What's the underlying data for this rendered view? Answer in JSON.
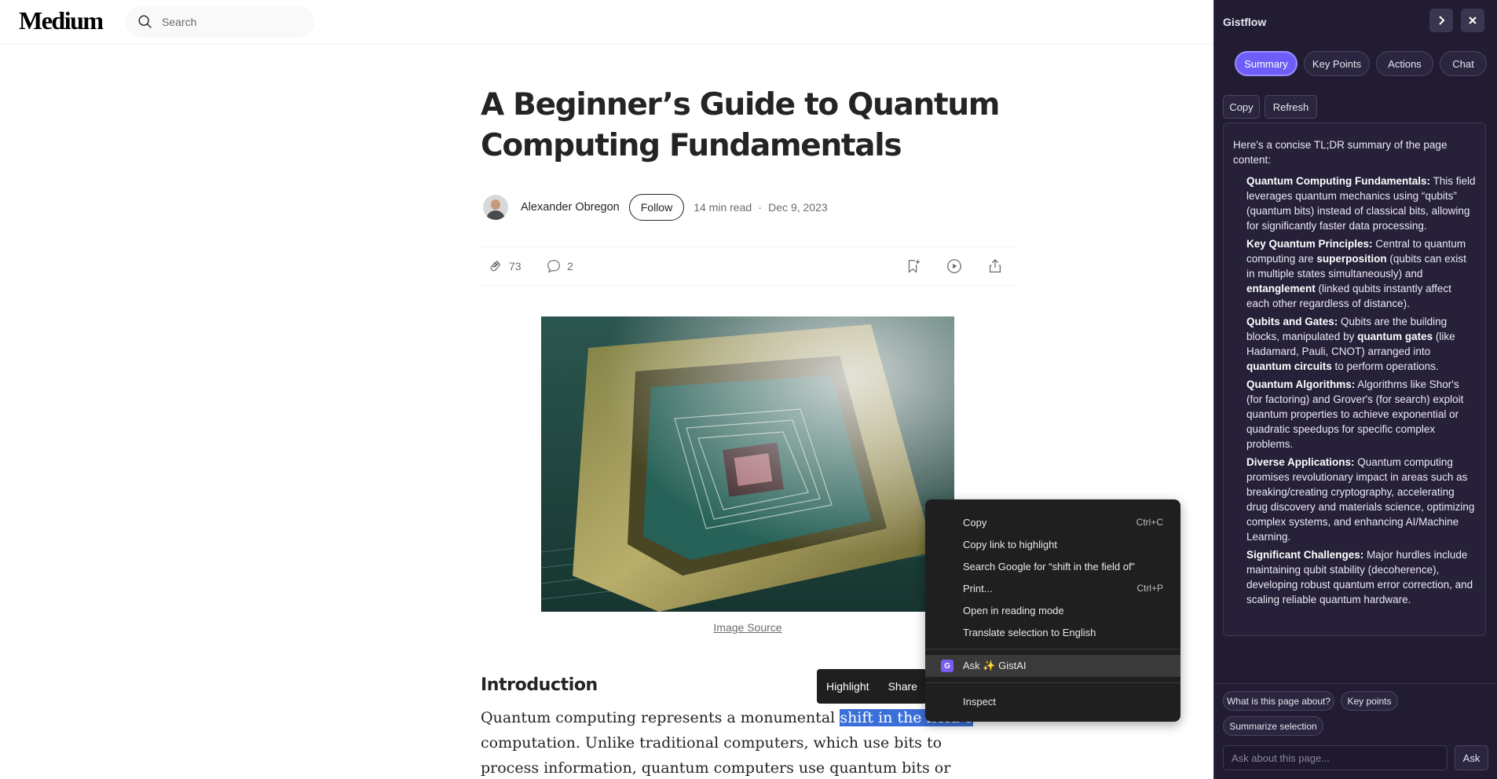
{
  "header": {
    "logo": "Medium",
    "search_placeholder": "Search"
  },
  "article": {
    "title": "A Beginner’s Guide to Quantum Computing Fundamentals",
    "author": "Alexander Obregon",
    "follow_label": "Follow",
    "read_time": "14 min read",
    "separator": "·",
    "date": "Dec 9, 2023",
    "claps": "73",
    "comments": "2",
    "image_caption": "Image Source",
    "section_heading": "Introduction",
    "paragraph_before": "Quantum computing represents a monumental ",
    "paragraph_selected": "shift in the field o",
    "paragraph_after": "computation. Unlike traditional computers, which use bits to process information, quantum computers use quantum bits or qubits. This"
  },
  "highlight_popup": {
    "highlight": "Highlight",
    "share": "Share"
  },
  "context_menu": {
    "items": [
      {
        "label": "Copy",
        "shortcut": "Ctrl+C"
      },
      {
        "label": "Copy link to highlight",
        "shortcut": ""
      },
      {
        "label": "Search Google for “shift in the field of”",
        "shortcut": ""
      },
      {
        "label": "Print...",
        "shortcut": "Ctrl+P"
      },
      {
        "label": "Open in reading mode",
        "shortcut": ""
      },
      {
        "label": "Translate selection to English",
        "shortcut": ""
      }
    ],
    "gist_item": "Ask ✨ GistAI",
    "inspect": "Inspect"
  },
  "sidebar": {
    "title": "Gistflow",
    "tabs": [
      "Summary",
      "Key Points",
      "Actions",
      "Chat"
    ],
    "active_tab": "Summary",
    "tools": [
      "Copy",
      "Refresh"
    ],
    "summary_intro": "Here's a concise TL;DR summary of the page content:",
    "points": [
      {
        "head": "Quantum Computing Fundamentals:",
        "text": " This field leverages quantum mechanics using “qubits” (quantum bits) instead of classical bits, allowing for significantly faster data processing."
      },
      {
        "head": "Key Quantum Principles:",
        "t1": " Central to quantum computing are ",
        "b1": "superposition",
        "t2": " (qubits can exist in multiple states simultaneously) and ",
        "b2": "entanglement",
        "t3": " (linked qubits instantly affect each other regardless of distance)."
      },
      {
        "head": "Qubits and Gates:",
        "t1": " Qubits are the building blocks, manipulated by ",
        "b1": "quantum gates",
        "t2": " (like Hadamard, Pauli, CNOT) arranged into ",
        "b2": "quantum circuits",
        "t3": " to perform operations."
      },
      {
        "head": "Quantum Algorithms:",
        "text": " Algorithms like Shor's (for factoring) and Grover's (for search) exploit quantum properties to achieve exponential or quadratic speedups for specific complex problems."
      },
      {
        "head": "Diverse Applications:",
        "text": " Quantum computing promises revolutionary impact in areas such as breaking/creating cryptography, accelerating drug discovery and materials science, optimizing complex systems, and enhancing AI/Machine Learning."
      },
      {
        "head": "Significant Challenges:",
        "text": " Major hurdles include maintaining qubit stability (decoherence), developing robust quantum error correction, and scaling reliable quantum hardware."
      }
    ],
    "chips": [
      "What is this page about?",
      "Key points",
      "Summarize selection"
    ],
    "ask_placeholder": "Ask about this page...",
    "ask_button": "Ask"
  },
  "colors": {
    "accent": "#6d5ef7",
    "sidebar_bg": "#221c33",
    "selection": "#3b6fd8",
    "context_menu_bg": "#1f1f1f"
  }
}
